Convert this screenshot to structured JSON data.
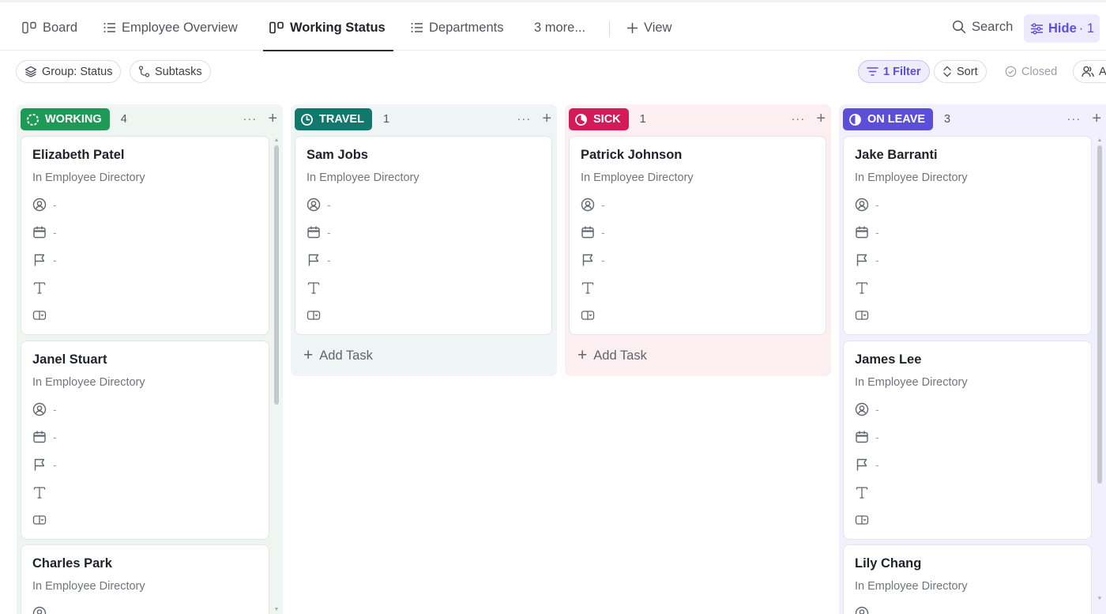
{
  "tabs": [
    {
      "label": "Board",
      "icon": "board-icon"
    },
    {
      "label": "Employee Overview",
      "icon": "list-icon"
    },
    {
      "label": "Working Status",
      "icon": "board-icon",
      "active": true
    },
    {
      "label": "Departments",
      "icon": "list-icon"
    },
    {
      "label": "3 more..."
    },
    {
      "label": "View",
      "icon": "plus-icon"
    }
  ],
  "toolbar": {
    "search_label": "Search",
    "hide_label": "Hide",
    "hide_count": "· 1"
  },
  "filters": {
    "group_label": "Group: Status",
    "subtasks_label": "Subtasks",
    "filter_label": "1 Filter",
    "sort_label": "Sort",
    "closed_label": "Closed",
    "assignee_label": "A"
  },
  "columns": [
    {
      "status": "WORKING",
      "count": "4",
      "color": "#1f9956",
      "cards": [
        {
          "name": "Elizabeth Patel",
          "location": "In Employee Directory"
        },
        {
          "name": "Janel Stuart",
          "location": "In Employee Directory"
        },
        {
          "name": "Charles Park",
          "location": "In Employee Directory"
        }
      ]
    },
    {
      "status": "TRAVEL",
      "count": "1",
      "color": "#11796c",
      "add_task": "Add Task",
      "cards": [
        {
          "name": "Sam Jobs",
          "location": "In Employee Directory"
        }
      ]
    },
    {
      "status": "SICK",
      "count": "1",
      "color": "#d21b58",
      "add_task": "Add Task",
      "cards": [
        {
          "name": "Patrick Johnson",
          "location": "In Employee Directory"
        }
      ]
    },
    {
      "status": "ON LEAVE",
      "count": "3",
      "color": "#5b4fd9",
      "cards": [
        {
          "name": "Jake Barranti",
          "location": "In Employee Directory"
        },
        {
          "name": "James Lee",
          "location": "In Employee Directory"
        },
        {
          "name": "Lily Chang",
          "location": "In Employee Directory"
        }
      ]
    }
  ],
  "card_fields": {
    "empty_value": "-",
    "icons": [
      "assignee-icon",
      "calendar-icon",
      "priority-flag-icon",
      "text-field-icon",
      "custom-field-icon"
    ]
  }
}
